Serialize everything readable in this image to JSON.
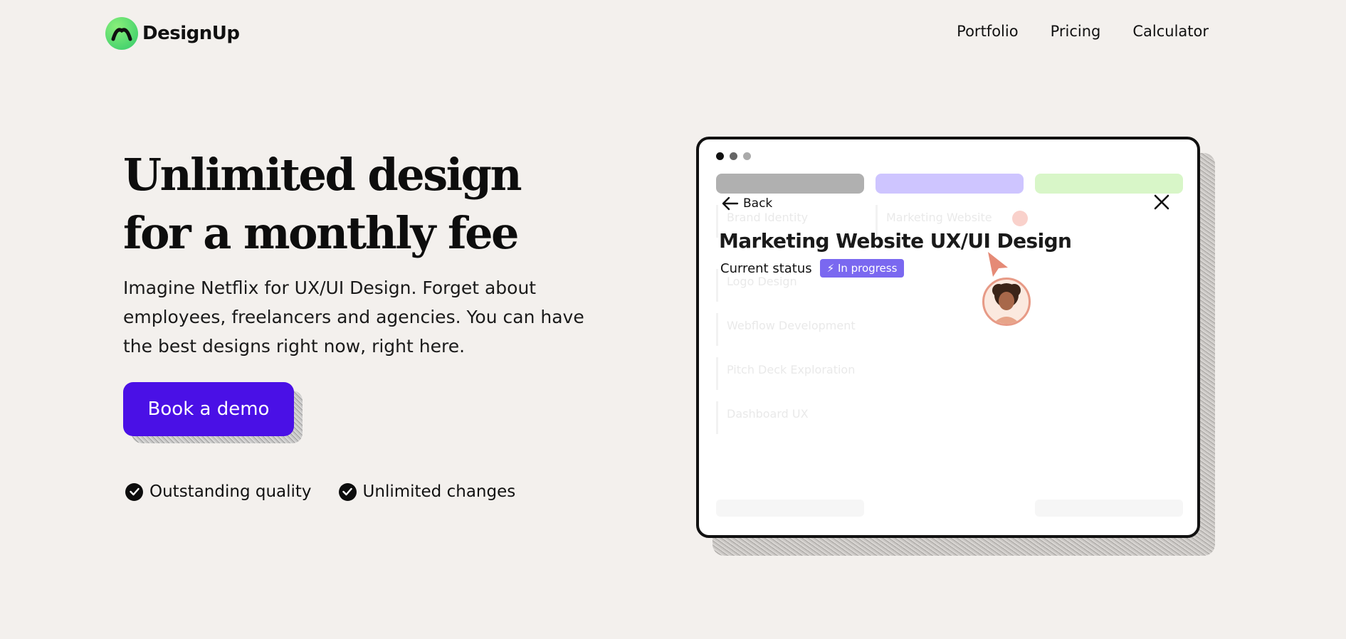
{
  "brand": {
    "name": "DesignUp",
    "accent": "#4a10e6",
    "logo_color": "#3fd36b"
  },
  "nav": {
    "items": [
      {
        "label": "Portfolio"
      },
      {
        "label": "Pricing"
      },
      {
        "label": "Calculator"
      }
    ]
  },
  "hero": {
    "title_line1": "Unlimited design",
    "title_line2": "for a monthly fee",
    "subtitle": "Imagine Netflix for UX/UI Design. Forget about employees, freelancers and agencies. You can have the best designs right now, right here.",
    "cta_label": "Book a demo",
    "features": [
      {
        "label": "Outstanding quality",
        "icon": "check-circle-icon"
      },
      {
        "label": "Unlimited changes",
        "icon": "check-circle-icon"
      }
    ]
  },
  "mockup": {
    "back_label": "Back",
    "task_title": "Marketing Website UX/UI Design",
    "status_label": "Current status",
    "status_value": "⚡ In progress",
    "status_color": "#7a68f0",
    "columns": [
      {
        "color": "#8e8e8e",
        "cards": [
          "Brand Identity",
          "Logo Design",
          "Webflow Development",
          "Pitch Deck Exploration",
          "Dashboard UX"
        ]
      },
      {
        "color": "#b9adff",
        "cards": [
          "Marketing Website"
        ]
      },
      {
        "color": "#b8ee9b",
        "cards": []
      }
    ]
  }
}
